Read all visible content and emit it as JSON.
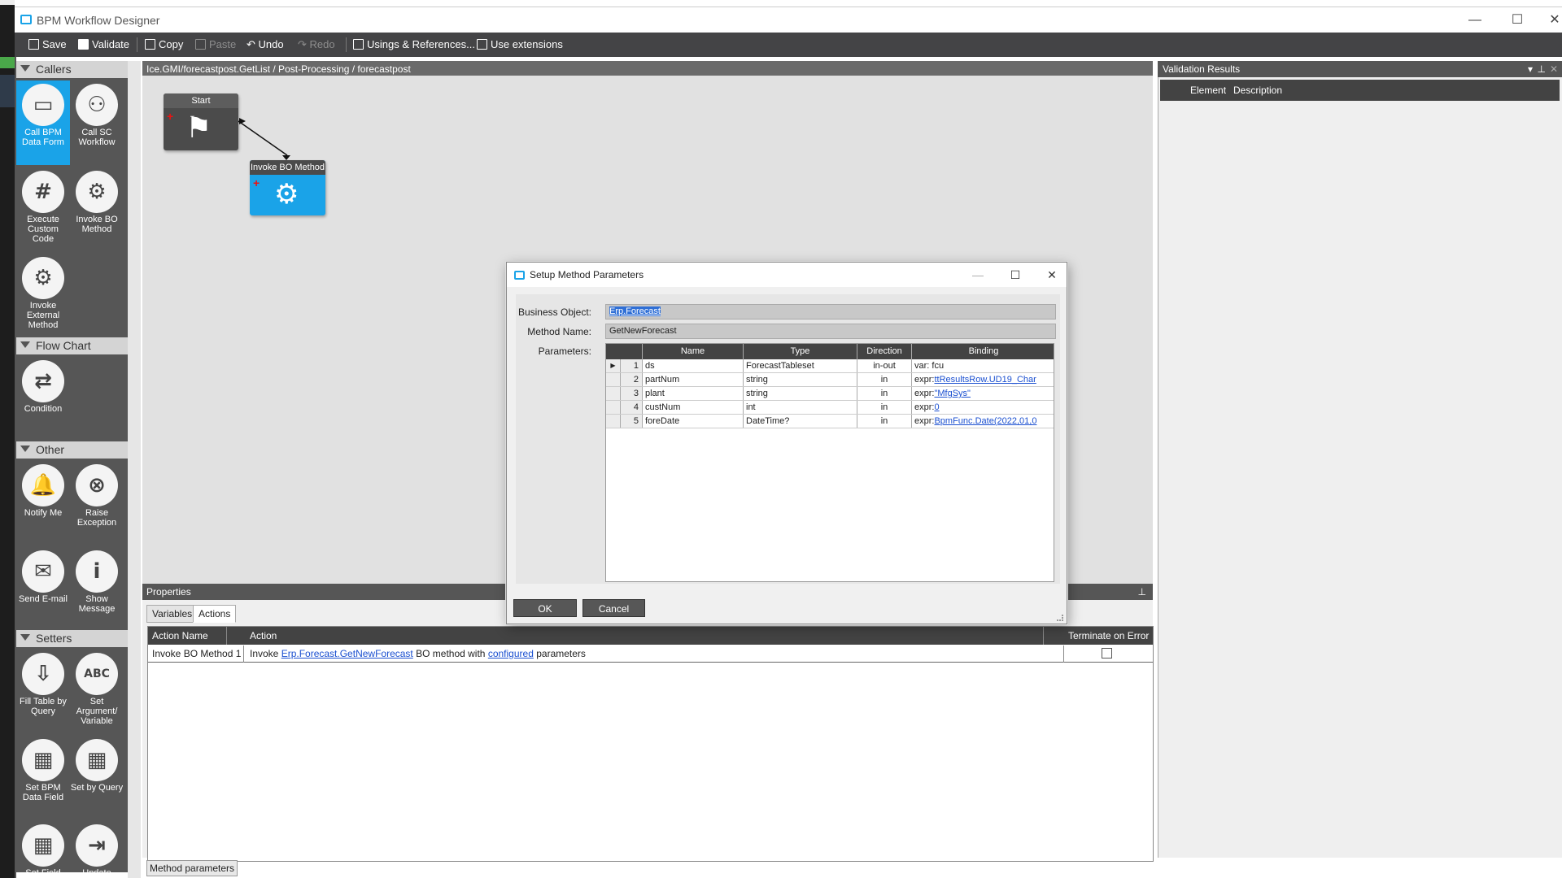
{
  "window": {
    "title": "BPM Workflow Designer",
    "minimize": "—",
    "maximize": "☐",
    "close": "✕"
  },
  "toolbar": {
    "save": "Save",
    "validate": "Validate",
    "copy": "Copy",
    "paste": "Paste",
    "undo": "Undo",
    "redo": "Redo",
    "usings": "Usings & References...",
    "extensions": "Use extensions"
  },
  "breadcrumb": "Ice.GMI/forecastpost.GetList / Post-Processing / forecastpost",
  "palette": {
    "callers": {
      "title": "Callers",
      "items": [
        "Call BPM Data Form",
        "Call SC Workflow",
        "Execute Custom Code",
        "Invoke BO Method",
        "Invoke External Method"
      ]
    },
    "flowchart": {
      "title": "Flow Chart",
      "items": [
        "Condition"
      ]
    },
    "other": {
      "title": "Other",
      "items": [
        "Notify Me",
        "Raise Exception",
        "Send E-mail",
        "Show Message"
      ]
    },
    "setters": {
      "title": "Setters",
      "items": [
        "Fill Table by Query",
        "Set Argument/ Variable",
        "Set BPM Data Field",
        "Set by Query",
        "Set Field",
        "Update"
      ]
    }
  },
  "canvas": {
    "start_node": "Start",
    "invoke_node": "Invoke BO Method"
  },
  "validation": {
    "title": "Validation Results",
    "col_element": "Element",
    "col_description": "Description"
  },
  "properties": {
    "title": "Properties",
    "tabs": [
      "Variables",
      "Actions"
    ],
    "columns": {
      "action_name": "Action Name",
      "action": "Action",
      "terminate": "Terminate on Error"
    },
    "row": {
      "name": "Invoke BO Method 1",
      "prefix": "Invoke",
      "method_link": "Erp.Forecast.GetNewForecast",
      "mid": "BO method with",
      "config_link": "configured",
      "suffix": "parameters"
    },
    "bottom_tab": "Method parameters"
  },
  "dialog": {
    "title": "Setup Method Parameters",
    "labels": {
      "business_object": "Business Object:",
      "method_name": "Method Name:",
      "parameters": "Parameters:"
    },
    "business_object": "Erp.Forecast",
    "method_name": "GetNewForecast",
    "columns": {
      "name": "Name",
      "type": "Type",
      "direction": "Direction",
      "binding": "Binding"
    },
    "params": [
      {
        "num": "1",
        "name": "ds",
        "type": "ForecastTableset",
        "direction": "in-out",
        "bind_prefix": "var: fcu",
        "bind_link": ""
      },
      {
        "num": "2",
        "name": "partNum",
        "type": "string",
        "direction": "in",
        "bind_prefix": "expr:",
        "bind_link": "ttResultsRow.UD19_Char"
      },
      {
        "num": "3",
        "name": "plant",
        "type": "string",
        "direction": "in",
        "bind_prefix": "expr:",
        "bind_link": "\"MfgSys\""
      },
      {
        "num": "4",
        "name": "custNum",
        "type": "int",
        "direction": "in",
        "bind_prefix": "expr:",
        "bind_link": "0"
      },
      {
        "num": "5",
        "name": "foreDate",
        "type": "DateTime?",
        "direction": "in",
        "bind_prefix": "expr:",
        "bind_link": "BpmFunc.Date(2022,01,0"
      }
    ],
    "ok": "OK",
    "cancel": "Cancel"
  },
  "colors": {
    "accent": "#1aa3e8",
    "dark": "#444446",
    "palette_bg": "#565656"
  }
}
